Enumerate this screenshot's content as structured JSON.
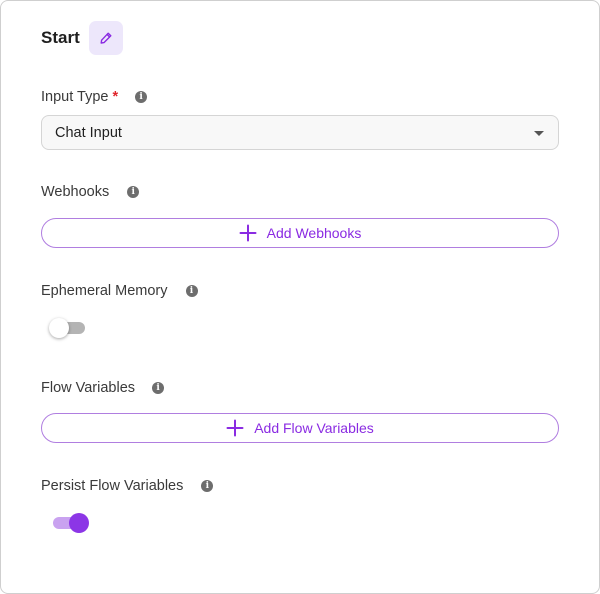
{
  "header": {
    "title": "Start"
  },
  "input_type": {
    "label": "Input Type",
    "required_mark": "*",
    "value": "Chat Input"
  },
  "webhooks": {
    "label": "Webhooks",
    "button_label": "Add Webhooks"
  },
  "ephemeral_memory": {
    "label": "Ephemeral Memory",
    "enabled": false
  },
  "flow_variables": {
    "label": "Flow Variables",
    "button_label": "Add Flow Variables"
  },
  "persist_flow_variables": {
    "label": "Persist Flow Variables",
    "enabled": true
  },
  "colors": {
    "accent": "#8c36e6",
    "required": "#e0262c",
    "edit_bg": "#ede7fb"
  },
  "icons": {
    "edit": "pencil-icon",
    "info": "info-icon",
    "add": "plus-icon",
    "select": "chevron-down-icon"
  }
}
